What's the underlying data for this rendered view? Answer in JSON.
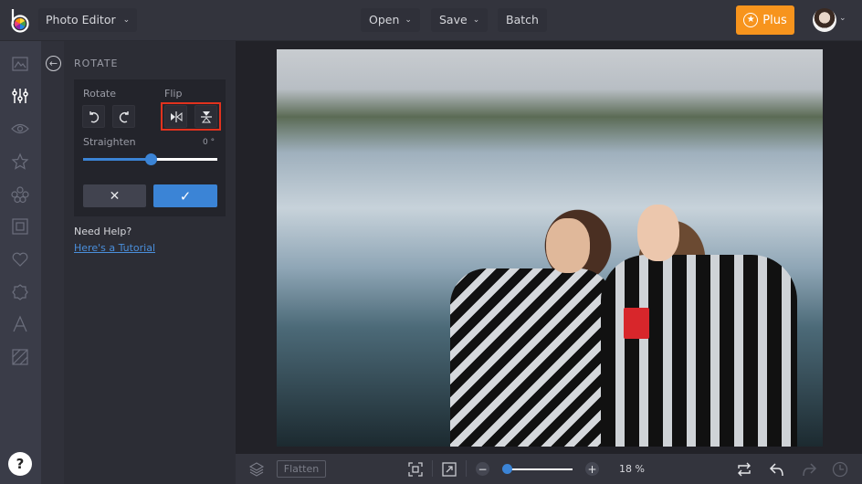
{
  "topbar": {
    "logo": "befunky-logo",
    "app_menu": "Photo Editor",
    "menus": [
      {
        "label": "Open",
        "has_dropdown": true
      },
      {
        "label": "Save",
        "has_dropdown": true
      },
      {
        "label": "Batch",
        "has_dropdown": false
      }
    ],
    "plus_label": "Plus",
    "plus_color": "#f7941d"
  },
  "sidebar": {
    "items": [
      {
        "icon": "image-icon",
        "label": "Image"
      },
      {
        "icon": "sliders-icon",
        "label": "Edit",
        "active": true
      },
      {
        "icon": "eye-icon",
        "label": "Touch Up"
      },
      {
        "icon": "star-icon",
        "label": "Effects"
      },
      {
        "icon": "flower-icon",
        "label": "Artsy"
      },
      {
        "icon": "frame-icon",
        "label": "Frames"
      },
      {
        "icon": "heart-icon",
        "label": "Graphics"
      },
      {
        "icon": "badge-icon",
        "label": "Overlays"
      },
      {
        "icon": "text-icon",
        "label": "Text"
      },
      {
        "icon": "texture-icon",
        "label": "Textures"
      }
    ],
    "help_label": "?"
  },
  "panel": {
    "title": "ROTATE",
    "rotate_label": "Rotate",
    "flip_label": "Flip",
    "straighten_label": "Straighten",
    "straighten_value": "0 °",
    "straighten_fraction": 0.5,
    "cancel_symbol": "✕",
    "apply_symbol": "✓",
    "help_title": "Need Help?",
    "help_link": "Here's a Tutorial",
    "accent_color": "#3b84d6",
    "highlight_color": "#e1321e"
  },
  "bottombar": {
    "flatten_label": "Flatten",
    "zoom_value": "18 %",
    "zoom_fraction": 0.0
  }
}
